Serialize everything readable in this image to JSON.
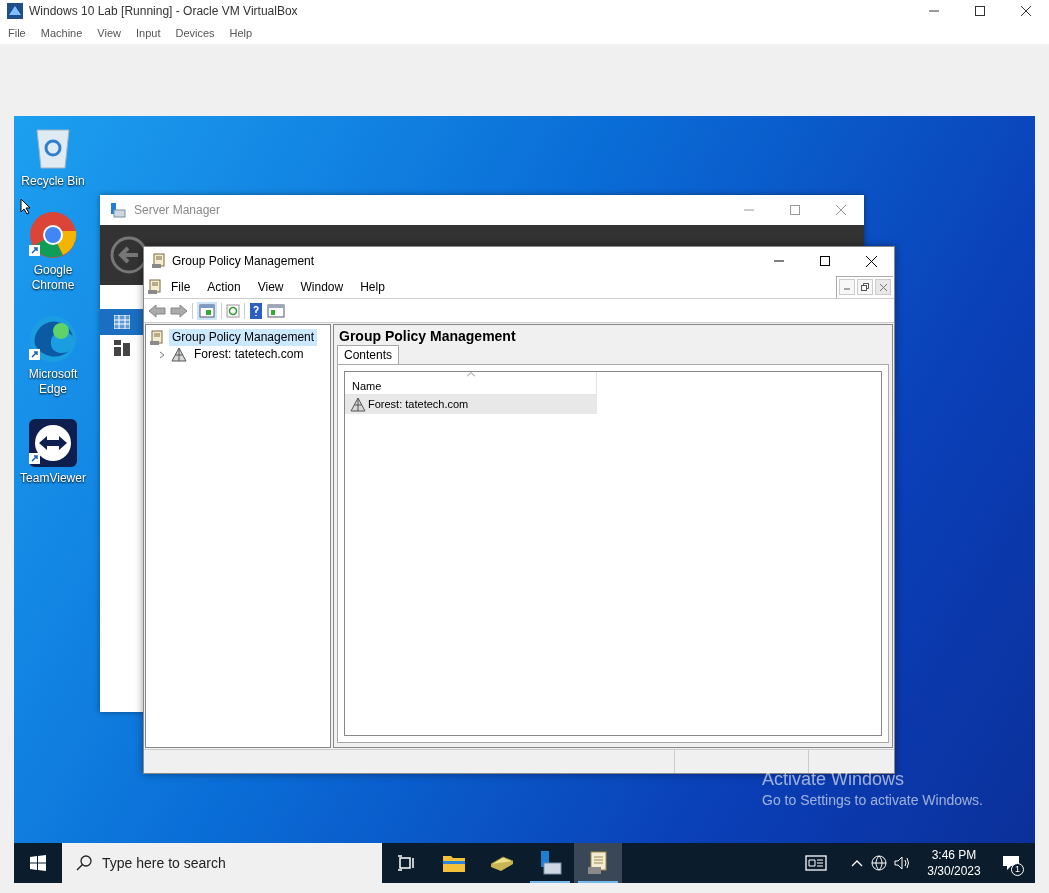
{
  "host_window": {
    "title": "Windows 10 Lab [Running] - Oracle VM VirtualBox",
    "menu": [
      "File",
      "Machine",
      "View",
      "Input",
      "Devices",
      "Help"
    ]
  },
  "desktop_icons": [
    {
      "label": "Recycle Bin",
      "kind": "recycle",
      "shortcut": false
    },
    {
      "label": "Google Chrome",
      "kind": "chrome",
      "shortcut": true
    },
    {
      "label": "Microsoft Edge",
      "kind": "edge",
      "shortcut": true
    },
    {
      "label": "TeamViewer",
      "kind": "teamviewer",
      "shortcut": true
    }
  ],
  "server_manager": {
    "title": "Server Manager"
  },
  "gpm": {
    "title": "Group Policy Management",
    "menu": [
      "File",
      "Action",
      "View",
      "Window",
      "Help"
    ],
    "tree": [
      {
        "label": "Group Policy Management",
        "kind": "gpm",
        "selected": true,
        "children": [
          {
            "label": "Forest: tatetech.com",
            "kind": "forest",
            "selected": false,
            "expanded": false
          }
        ]
      }
    ],
    "heading": "Group Policy Management",
    "tabs": [
      {
        "label": "Contents",
        "selected": true
      }
    ],
    "columns": [
      "Name"
    ],
    "rows": [
      {
        "name": "Forest: tatetech.com",
        "selected": true
      }
    ]
  },
  "activation": {
    "title": "Activate Windows",
    "subtitle": "Go to Settings to activate Windows."
  },
  "taskbar": {
    "search_placeholder": "Type here to search",
    "apps": [
      {
        "kind": "taskview",
        "running": false,
        "selected": false
      },
      {
        "kind": "explorer",
        "running": false,
        "selected": false
      },
      {
        "kind": "drive",
        "running": false,
        "selected": false
      },
      {
        "kind": "servermanager",
        "running": true,
        "selected": false
      },
      {
        "kind": "gpm",
        "running": true,
        "selected": true
      }
    ],
    "time": "3:46 PM",
    "date": "3/30/2023",
    "notifications": "1"
  }
}
